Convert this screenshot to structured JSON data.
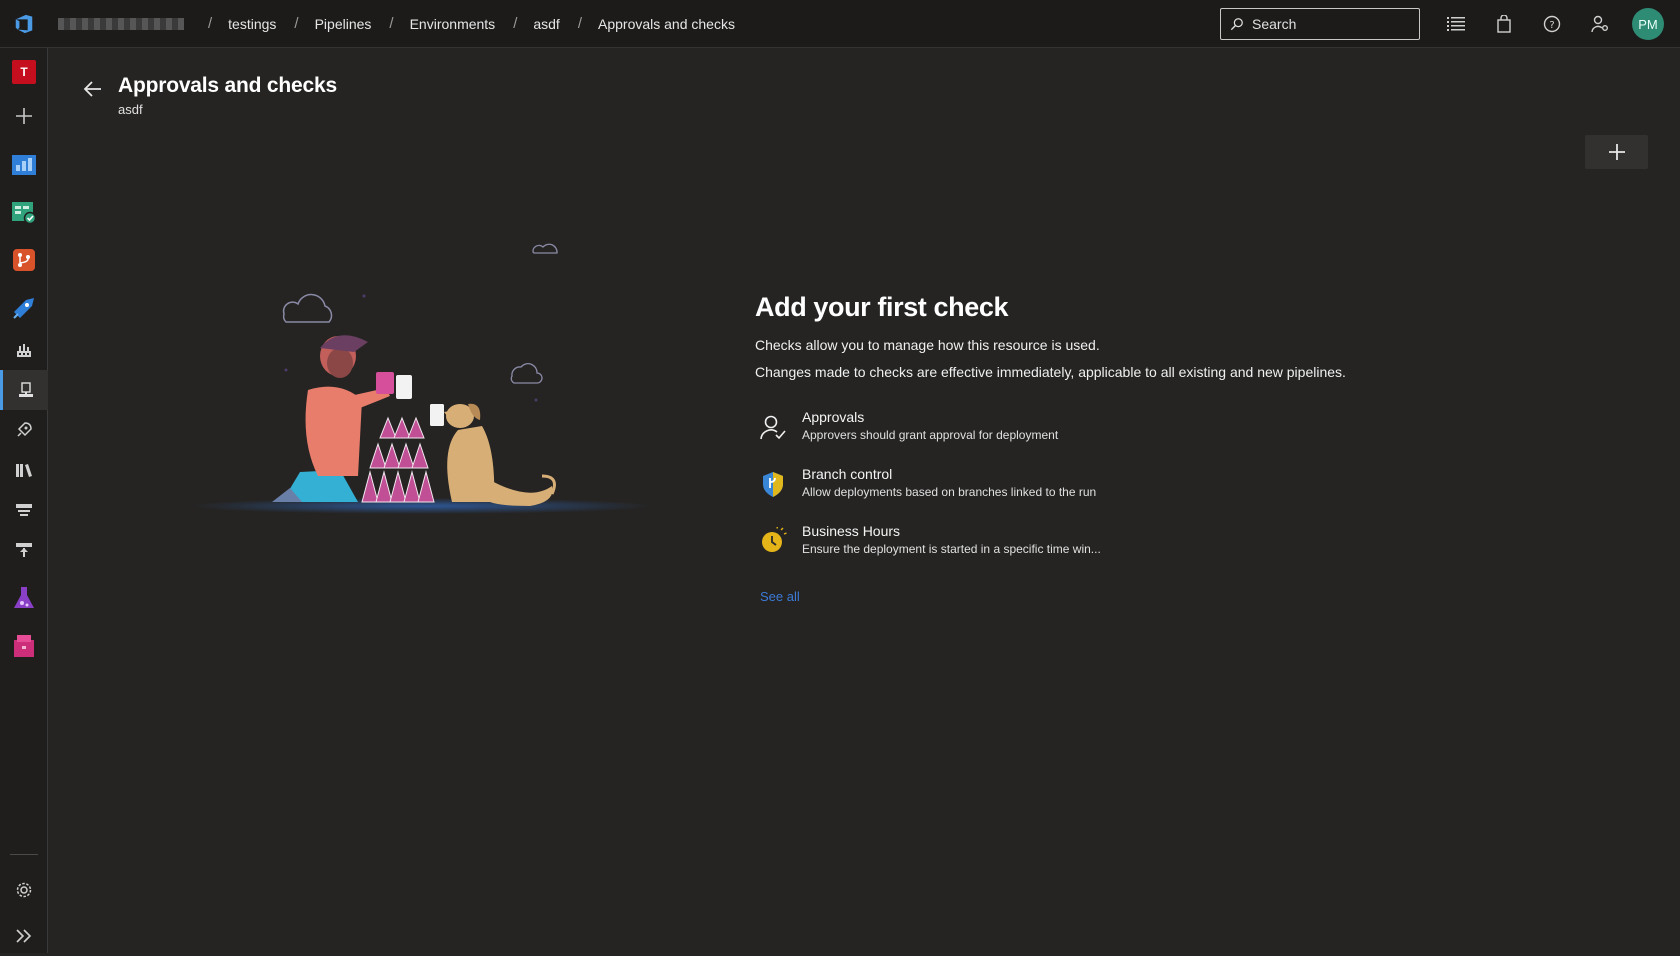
{
  "breadcrumb": {
    "items": [
      "testings",
      "Pipelines",
      "Environments",
      "asdf",
      "Approvals and checks"
    ],
    "separator": "/"
  },
  "topbar": {
    "search_placeholder": "Search",
    "avatar_initials": "PM",
    "icons": [
      "list-icon",
      "shopping-bag-icon",
      "help-icon",
      "user-settings-icon"
    ]
  },
  "sidebar": {
    "project_initial": "T",
    "items": [
      "new-project-icon",
      "overview-icon",
      "boards-icon",
      "repos-icon",
      "pipelines-icon",
      "pipelines-sub-icon",
      "environments-icon",
      "releases-icon",
      "library-icon",
      "task-groups-icon",
      "deployment-groups-icon",
      "test-plans-icon",
      "artifacts-icon"
    ],
    "selected": "environments-icon",
    "footer": [
      "settings-icon",
      "expand-icon"
    ]
  },
  "page": {
    "title": "Approvals and checks",
    "subtitle": "asdf"
  },
  "empty_state": {
    "title": "Add your first check",
    "line1": "Checks allow you to manage how this resource is used.",
    "line2": "Changes made to checks are effective immediately, applicable to all existing and new pipelines.",
    "checks": [
      {
        "title": "Approvals",
        "desc": "Approvers should grant approval for deployment",
        "icon": "person-check-icon"
      },
      {
        "title": "Branch control",
        "desc": "Allow deployments based on branches linked to the run",
        "icon": "shield-icon"
      },
      {
        "title": "Business Hours",
        "desc": "Ensure the deployment is started in a specific time win...",
        "icon": "clock-icon"
      }
    ],
    "see_all": "See all"
  },
  "colors": {
    "background": "#252423",
    "topbar": "#1c1b1a",
    "link": "#3b7ad6",
    "avatar": "#2e8b74",
    "project_badge": "#c50f1f"
  }
}
